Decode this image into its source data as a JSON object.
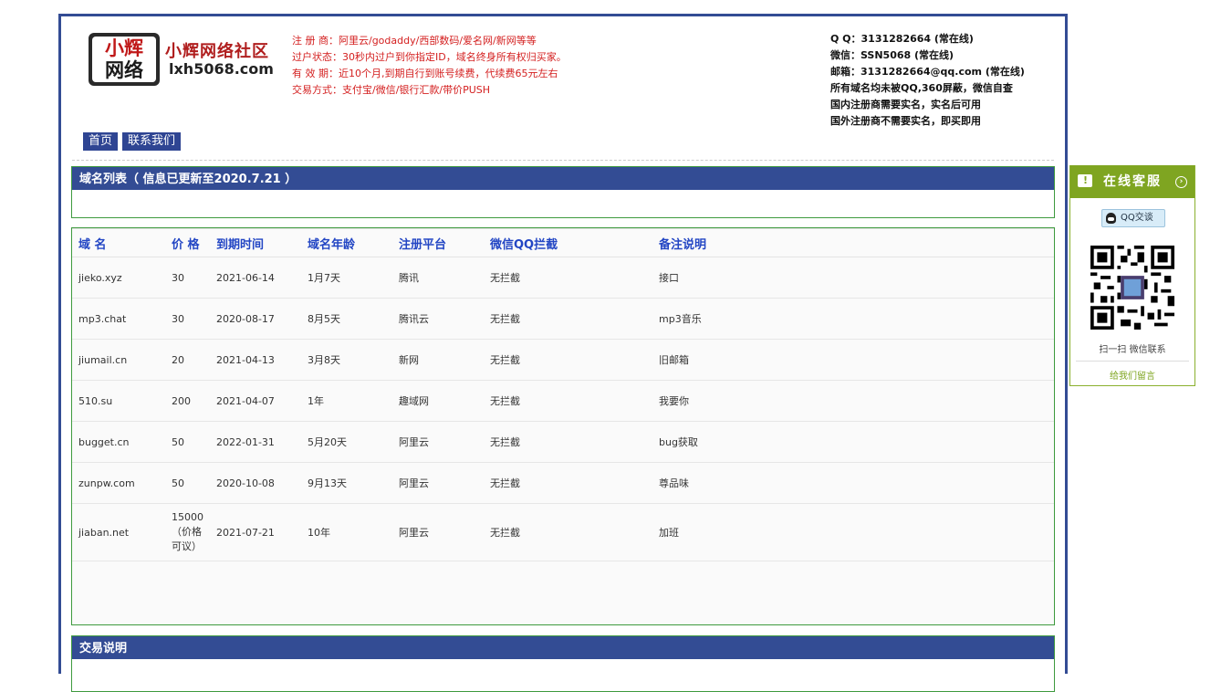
{
  "header": {
    "logo_line1": "小辉",
    "logo_line2": "网络",
    "brand_name": "小辉网络社区",
    "brand_domain": "lxh5068.com",
    "notice": [
      "注 册 商：阿里云/godaddy/西部数码/爱名网/新网等等",
      "过户状态：30秒内过户到你指定ID，域名终身所有权归买家。",
      "有 效 期：近10个月,到期自行到账号续费，代续费65元左右",
      "交易方式：支付宝/微信/银行汇款/带价PUSH"
    ],
    "contact": [
      "Q Q：3131282664 (常在线)",
      "微信：SSN5068 (常在线)",
      "邮箱：3131282664@qq.com (常在线)",
      "所有域名均未被QQ,360屏蔽，微信自查",
      "国内注册商需要实名，实名后可用",
      "国外注册商不需要实名，即买即用"
    ]
  },
  "nav": {
    "home": "首页",
    "contact": "联系我们"
  },
  "domain_panel": {
    "title": "域名列表（ 信息已更新至2020.7.21 ）"
  },
  "table": {
    "headers": [
      "域 名",
      "价 格",
      "到期时间",
      "域名年龄",
      "注册平台",
      "微信QQ拦截",
      "备注说明"
    ],
    "rows": [
      {
        "domain": "jieko.xyz",
        "price": "30",
        "expiry": "2021-06-14",
        "age": "1月7天",
        "registrar": "腾讯",
        "blocked": "无拦截",
        "note": "接口"
      },
      {
        "domain": "mp3.chat",
        "price": "30",
        "expiry": "2020-08-17",
        "age": "8月5天",
        "registrar": "腾讯云",
        "blocked": "无拦截",
        "note": "mp3音乐"
      },
      {
        "domain": "jiumail.cn",
        "price": "20",
        "expiry": "2021-04-13",
        "age": "3月8天",
        "registrar": "新网",
        "blocked": "无拦截",
        "note": "旧邮箱"
      },
      {
        "domain": "510.su",
        "price": "200",
        "expiry": "2021-04-07",
        "age": "1年",
        "registrar": "趣域网",
        "blocked": "无拦截",
        "note": "我要你"
      },
      {
        "domain": "bugget.cn",
        "price": "50",
        "expiry": "2022-01-31",
        "age": "5月20天",
        "registrar": "阿里云",
        "blocked": "无拦截",
        "note": "bug获取"
      },
      {
        "domain": "zunpw.com",
        "price": "50",
        "expiry": "2020-10-08",
        "age": "9月13天",
        "registrar": "阿里云",
        "blocked": "无拦截",
        "note": "尊品味"
      },
      {
        "domain": "jiaban.net",
        "price_lines": [
          "15000",
          "（价格",
          "可议）"
        ],
        "expiry": "2021-07-21",
        "age": "10年",
        "registrar": "阿里云",
        "blocked": "无拦截",
        "note": "加班"
      }
    ]
  },
  "trade_panel": {
    "title": "交易说明"
  },
  "customer_service": {
    "title": "在线客服",
    "qq_button": "QQ交谈",
    "qr_caption": "扫一扫 微信联系",
    "message_link": "给我们留言"
  }
}
